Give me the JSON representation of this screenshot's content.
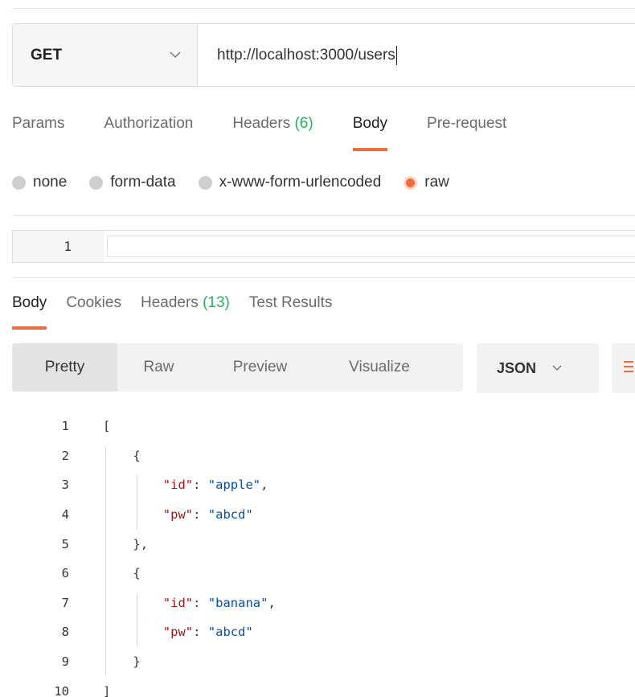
{
  "request": {
    "method": "GET",
    "url": "http://localhost:3000/users",
    "tabs": [
      {
        "label": "Params",
        "count": ""
      },
      {
        "label": "Authorization",
        "count": ""
      },
      {
        "label": "Headers",
        "count": "(6)"
      },
      {
        "label": "Body",
        "count": ""
      },
      {
        "label": "Pre-request",
        "count": ""
      }
    ],
    "body_types": [
      "none",
      "form-data",
      "x-www-form-urlencoded",
      "raw"
    ],
    "body_selected": "raw",
    "editor_line_number": "1"
  },
  "response": {
    "tabs": [
      {
        "label": "Body",
        "count": ""
      },
      {
        "label": "Cookies",
        "count": ""
      },
      {
        "label": "Headers",
        "count": "(13)"
      },
      {
        "label": "Test Results",
        "count": ""
      }
    ],
    "view_modes": [
      "Pretty",
      "Raw",
      "Preview",
      "Visualize"
    ],
    "format": "JSON",
    "lines": [
      {
        "n": "1",
        "t": "["
      },
      {
        "n": "2",
        "t": "{"
      },
      {
        "n": "3",
        "k": "\"id\"",
        "v": "\"apple\"",
        "end": ","
      },
      {
        "n": "4",
        "k": "\"pw\"",
        "v": "\"abcd\"",
        "end": ""
      },
      {
        "n": "5",
        "t": "},"
      },
      {
        "n": "6",
        "t": "{"
      },
      {
        "n": "7",
        "k": "\"id\"",
        "v": "\"banana\"",
        "end": ","
      },
      {
        "n": "8",
        "k": "\"pw\"",
        "v": "\"abcd\"",
        "end": ""
      },
      {
        "n": "9",
        "t": "}"
      },
      {
        "n": "10",
        "t": "]"
      }
    ]
  },
  "colors": {
    "accent": "#f26b3a",
    "count_green": "#26b05c",
    "json_key": "#a31515",
    "json_string": "#0451a5"
  }
}
